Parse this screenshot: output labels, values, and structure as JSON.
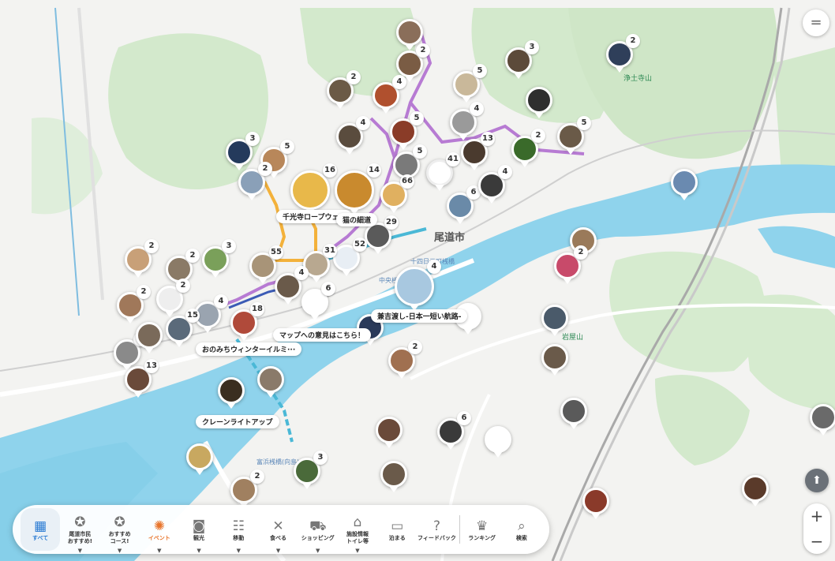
{
  "map": {
    "city_label": "尾道市",
    "place_labels": [
      {
        "text": "浄土寺山",
        "type": "park"
      },
      {
        "text": "岩屋山",
        "type": "park"
      },
      {
        "text": "十四日元町桟橋",
        "type": "pier"
      },
      {
        "text": "中央桟橋",
        "type": "pier"
      },
      {
        "text": "富浜桟橋(向島)",
        "type": "pier"
      }
    ],
    "callouts": [
      "千光寺ロープウェイ",
      "猫の細道",
      "マップへの意見はこちら！",
      "兼吉渡し-日本一短い航路-",
      "おのみちウィンターイルミ···",
      "クレーンライトアップ"
    ],
    "pin_counts": [
      "2",
      "2",
      "5",
      "4",
      "3",
      "2",
      "5",
      "4",
      "5",
      "13",
      "2",
      "5",
      "4",
      "3",
      "5",
      "16",
      "14",
      "66",
      "2",
      "41",
      "6",
      "4",
      "29",
      "52",
      "31",
      "55",
      "4",
      "3",
      "2",
      "2",
      "2",
      "4",
      "15",
      "18",
      "2",
      "3",
      "13",
      "6",
      "4",
      "2",
      "2",
      "6",
      "3",
      "2",
      "2"
    ]
  },
  "controls": {
    "menu_icon": "=",
    "compass_icon": "⬆",
    "zoom_in": "+",
    "zoom_out": "−"
  },
  "toolbar": {
    "items": [
      {
        "icon": "grid-icon",
        "glyph": "▦",
        "label": "すべて",
        "active": true,
        "dropdown": false
      },
      {
        "icon": "badge-icon",
        "glyph": "✪",
        "label": "尾道市民\nおすすめ!",
        "active": false,
        "dropdown": true
      },
      {
        "icon": "badge-icon",
        "glyph": "✪",
        "label": "おすすめ\nコース!",
        "active": false,
        "dropdown": true
      },
      {
        "icon": "firework-icon",
        "glyph": "✺",
        "label": "イベント",
        "active": false,
        "dropdown": true,
        "highlight": true
      },
      {
        "icon": "camera-icon",
        "glyph": "◙",
        "label": "観光",
        "active": false,
        "dropdown": true
      },
      {
        "icon": "people-icon",
        "glyph": "☷",
        "label": "移動",
        "active": false,
        "dropdown": true
      },
      {
        "icon": "utensils-icon",
        "glyph": "✕",
        "label": "食べる",
        "active": false,
        "dropdown": true
      },
      {
        "icon": "cart-icon",
        "glyph": "⛟",
        "label": "ショッピング",
        "active": false,
        "dropdown": true
      },
      {
        "icon": "house-icon",
        "glyph": "⌂",
        "label": "施設情報\nトイレ等",
        "active": false,
        "dropdown": true
      },
      {
        "icon": "bed-icon",
        "glyph": "▭",
        "label": "泊まる",
        "active": false,
        "dropdown": false
      },
      {
        "icon": "question-icon",
        "glyph": "?",
        "label": "フィードバック",
        "active": false,
        "dropdown": false
      },
      {
        "icon": "crown-icon",
        "glyph": "♛",
        "label": "ランキング",
        "active": false,
        "dropdown": false
      },
      {
        "icon": "search-icon",
        "glyph": "⌕",
        "label": "検索",
        "active": false,
        "dropdown": false
      }
    ]
  },
  "colors": {
    "sea": "#8fd3ec",
    "land": "#f2f2f0",
    "green": "#cfe8c8",
    "route_purple": "#b77bd3",
    "route_orange": "#f3b13a",
    "route_blue": "#4ab8d6",
    "accent": "#2a7bd3"
  }
}
